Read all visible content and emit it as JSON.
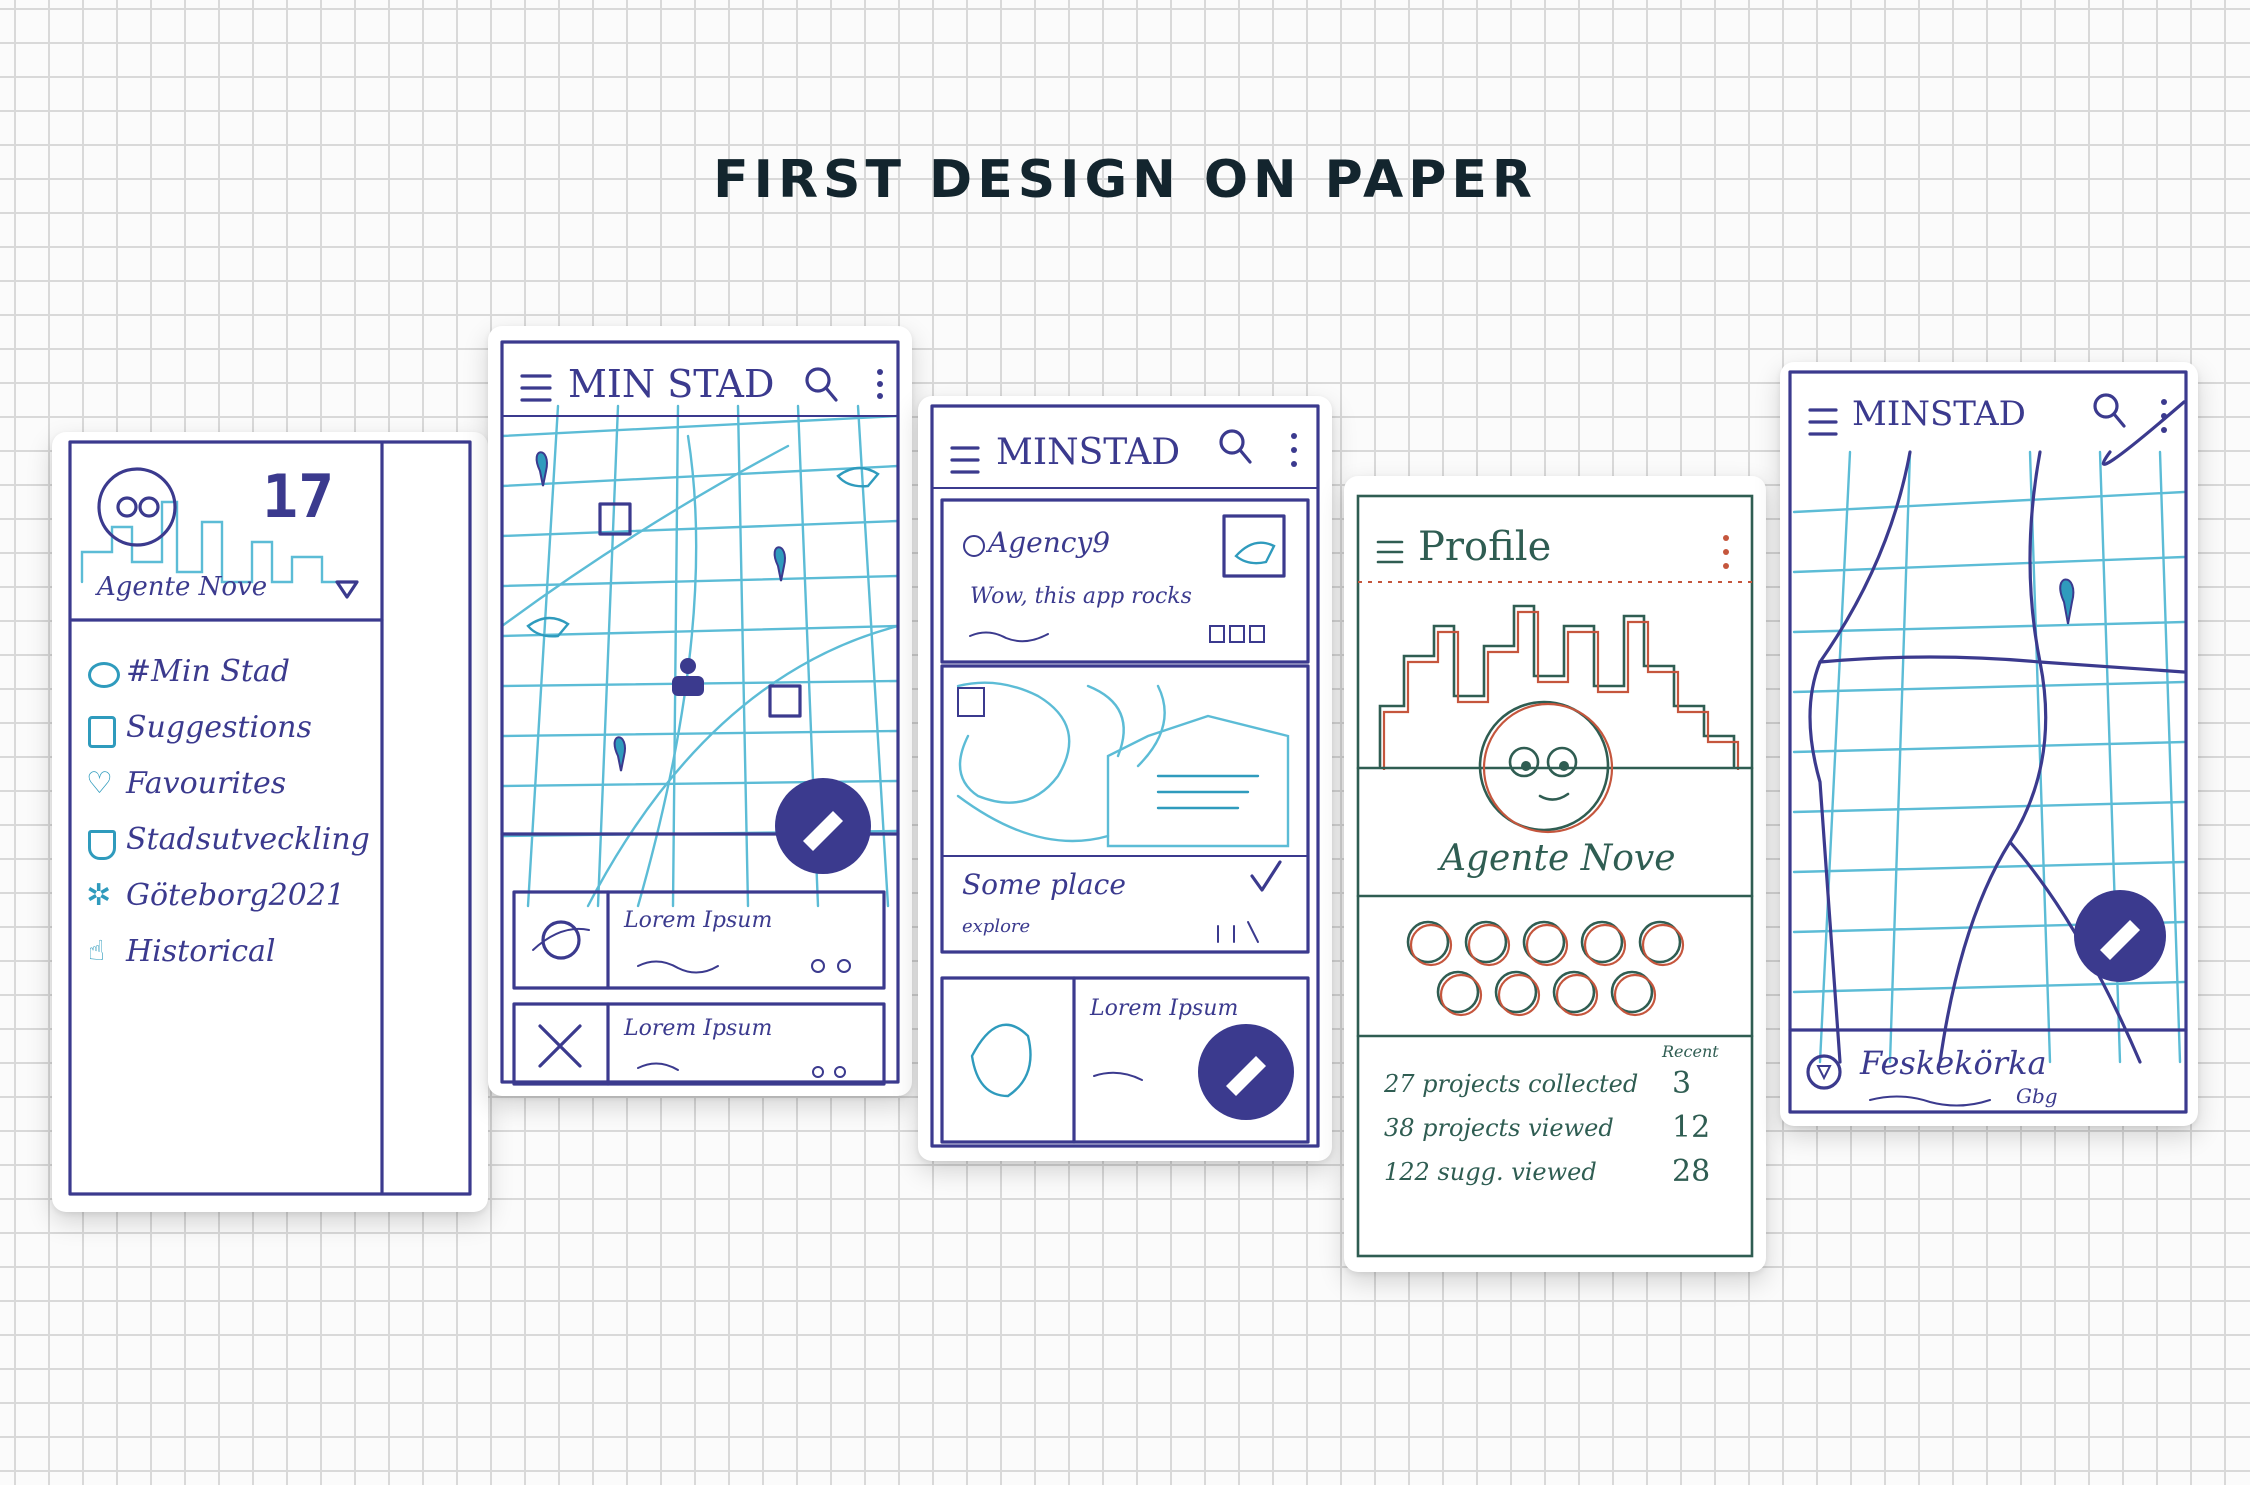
{
  "title": "FIRST DESIGN ON PAPER",
  "app_name": "MINSTAD",
  "colors": {
    "ink": "#3b3a8e",
    "teal": "#2f9bbd",
    "red": "#c5563d",
    "green": "#2f5d52",
    "title": "#13252e"
  },
  "drawer": {
    "badge": "17",
    "user_name": "Agente Nove",
    "menu": [
      {
        "label": "#Min Stad",
        "icon": "planet-icon"
      },
      {
        "label": "Suggestions",
        "icon": "thumb-icon"
      },
      {
        "label": "Favourites",
        "icon": "heart-icon"
      },
      {
        "label": "Stadsutveckling",
        "icon": "shield-icon"
      },
      {
        "label": "Göteborg2021",
        "icon": "star-icon"
      },
      {
        "label": "Historical",
        "icon": "hand-icon"
      }
    ]
  },
  "map_screen": {
    "app_title": "MIN STAD",
    "list_items": [
      {
        "title": "Lorem Ipsum"
      },
      {
        "title": "Lorem Ipsum"
      }
    ]
  },
  "feed_screen": {
    "app_title": "MINSTAD",
    "post": {
      "author": "Agency9",
      "text": "Wow, this app rocks"
    },
    "place": {
      "title": "Some place",
      "action": "explore"
    },
    "card3": {
      "title": "Lorem Ipsum"
    }
  },
  "profile_screen": {
    "title": "Profile",
    "user_name": "Agente Nove",
    "stats_header": "Recent",
    "stats": [
      {
        "label": "27 projects collected",
        "recent": "3"
      },
      {
        "label": "38 projects viewed",
        "recent": "12"
      },
      {
        "label": "122 sugg. viewed",
        "recent": "28"
      }
    ]
  },
  "route_screen": {
    "app_title": "MINSTAD",
    "place_name": "Feskekörka",
    "place_city": "Gbg"
  }
}
